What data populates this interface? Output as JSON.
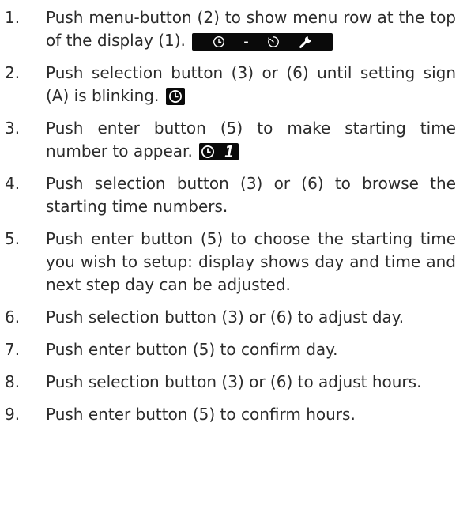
{
  "steps": [
    {
      "num": "1.",
      "text": "Push menu-button (2) to show menu row at the top of the display (1).",
      "display": {
        "icons": [
          "clock-icon",
          "dash",
          "timer-icon",
          "wrench-icon"
        ],
        "dash": "-"
      }
    },
    {
      "num": "2.",
      "text": "Push selection button (3) or (6) until setting sign (A) is blinking.",
      "display": {
        "icons": [
          "clock-icon"
        ]
      }
    },
    {
      "num": "3.",
      "text": "Push enter button (5) to make starting time number to appear.",
      "display": {
        "icons": [
          "clock-icon"
        ],
        "digit": "1"
      }
    },
    {
      "num": "4.",
      "text": "Push selection button (3) or (6) to browse the starting time numbers."
    },
    {
      "num": "5.",
      "text": "Push enter button (5) to choose the starting time you wish to setup: display shows day and time and next step day can be adjusted."
    },
    {
      "num": "6.",
      "text": "Push selection button (3) or (6) to adjust day."
    },
    {
      "num": "7.",
      "text": "Push enter button (5) to confirm day."
    },
    {
      "num": "8.",
      "text": "Push selection button (3) or (6) to adjust hours."
    },
    {
      "num": "9.",
      "text": "Push enter button (5) to confirm hours."
    }
  ],
  "colors": {
    "text": "#2b2b2b",
    "display_bg": "#0a0a0a",
    "display_fg": "#ffffff"
  }
}
